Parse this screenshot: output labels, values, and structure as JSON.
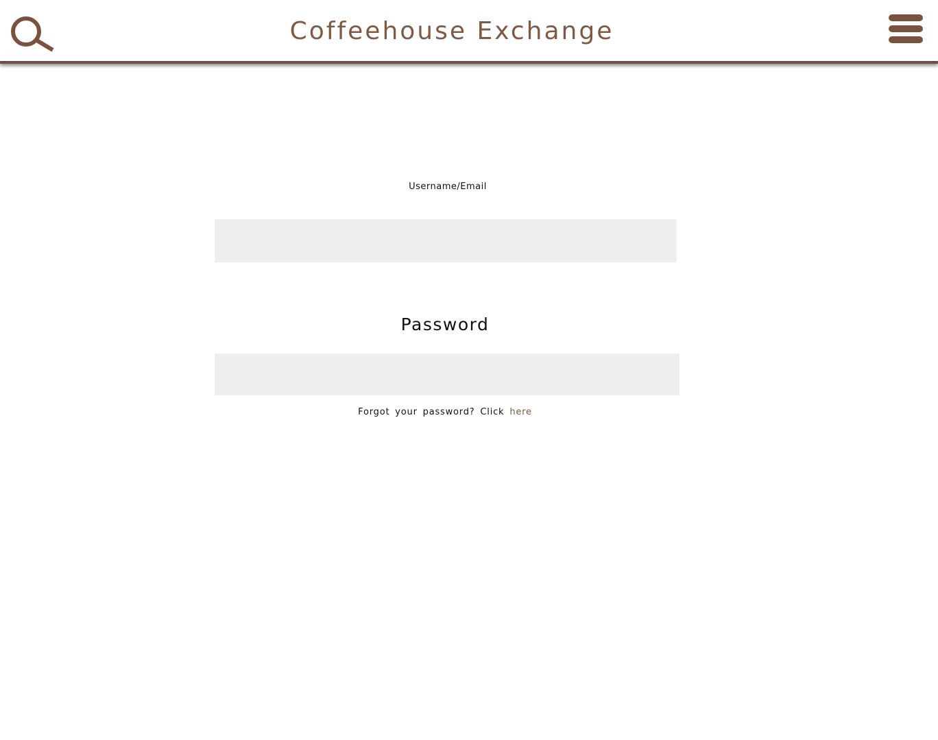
{
  "header": {
    "title": "Coffeehouse Exchange",
    "search_icon": "search-icon",
    "menu_icon": "hamburger-menu-icon"
  },
  "login": {
    "username_label": "Username/Email",
    "username_value": "",
    "password_label": "Password",
    "password_value": "",
    "forgot_text": "Forgot your password? Click",
    "forgot_link": "here"
  },
  "colors": {
    "brand": "#7d5a45",
    "header_border": "#6e5142",
    "input_bg": "#efefef"
  }
}
